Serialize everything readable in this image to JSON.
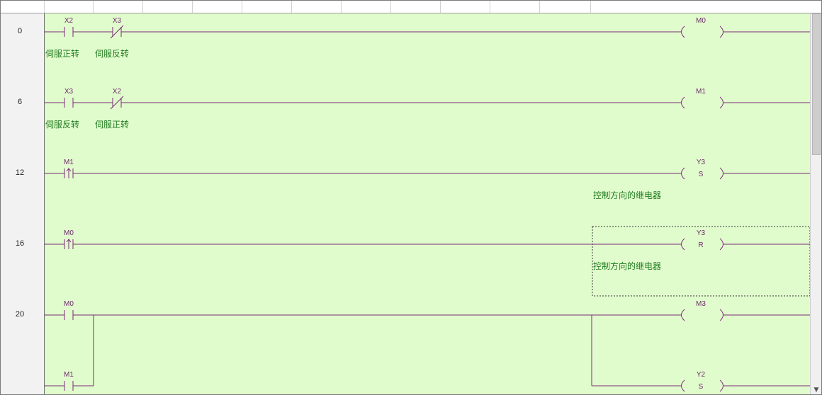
{
  "steps": [
    "0",
    "6",
    "12",
    "16",
    "20"
  ],
  "rungs": [
    {
      "contact1": {
        "device": "X2",
        "type": "NO",
        "comment": "伺服正转"
      },
      "contact2": {
        "device": "X3",
        "type": "NC",
        "comment": "伺服反转"
      },
      "coil": {
        "device": "M0",
        "instruction": ""
      }
    },
    {
      "contact1": {
        "device": "X3",
        "type": "NO",
        "comment": "伺服反转"
      },
      "contact2": {
        "device": "X2",
        "type": "NC",
        "comment": "伺服正转"
      },
      "coil": {
        "device": "M1",
        "instruction": ""
      }
    },
    {
      "contact1": {
        "device": "M1",
        "type": "rising-edge"
      },
      "coil": {
        "device": "Y3",
        "instruction": "S",
        "comment": "控制方向的继电器"
      }
    },
    {
      "contact1": {
        "device": "M0",
        "type": "rising-edge"
      },
      "coil": {
        "device": "Y3",
        "instruction": "R",
        "comment": "控制方向的继电器"
      }
    },
    {
      "contact1": {
        "device": "M0",
        "type": "NO"
      },
      "contact_parallel": {
        "device": "M1",
        "type": "NO"
      },
      "coil": {
        "device": "M3",
        "instruction": ""
      },
      "coil2": {
        "device": "Y2",
        "instruction": "S"
      }
    }
  ],
  "colors": {
    "ladder_background": "#e1fccc",
    "wire": "#7a2a7a",
    "comment_text": "#1f7a1f"
  }
}
